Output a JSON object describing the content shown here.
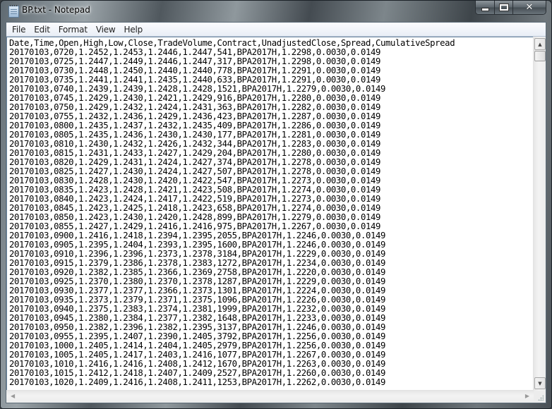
{
  "window": {
    "title": "BP.txt - Notepad",
    "app_icon": "notepad-icon",
    "caption_buttons": {
      "minimize": "minimize-icon",
      "maximize": "maximize-icon",
      "close": "close-icon"
    }
  },
  "menu": {
    "items": [
      "File",
      "Edit",
      "Format",
      "View",
      "Help"
    ]
  },
  "document": {
    "header": "Date,Time,Open,High,Low,Close,TradeVolume,Contract,UnadjustedClose,Spread,CumulativeSpread",
    "lines": [
      "20170103,0720,1.2452,1.2453,1.2446,1.2447,541,BPA2017H,1.2298,0.0030,0.0149",
      "20170103,0725,1.2447,1.2449,1.2446,1.2447,317,BPA2017H,1.2298,0.0030,0.0149",
      "20170103,0730,1.2448,1.2450,1.2440,1.2440,778,BPA2017H,1.2291,0.0030,0.0149",
      "20170103,0735,1.2441,1.2441,1.2435,1.2440,633,BPA2017H,1.2291,0.0030,0.0149",
      "20170103,0740,1.2439,1.2439,1.2428,1.2428,1521,BPA2017H,1.2279,0.0030,0.0149",
      "20170103,0745,1.2429,1.2430,1.2421,1.2429,916,BPA2017H,1.2280,0.0030,0.0149",
      "20170103,0750,1.2429,1.2432,1.2424,1.2431,363,BPA2017H,1.2282,0.0030,0.0149",
      "20170103,0755,1.2432,1.2436,1.2429,1.2436,423,BPA2017H,1.2287,0.0030,0.0149",
      "20170103,0800,1.2435,1.2437,1.2432,1.2435,409,BPA2017H,1.2286,0.0030,0.0149",
      "20170103,0805,1.2435,1.2436,1.2430,1.2430,177,BPA2017H,1.2281,0.0030,0.0149",
      "20170103,0810,1.2430,1.2432,1.2426,1.2432,344,BPA2017H,1.2283,0.0030,0.0149",
      "20170103,0815,1.2431,1.2433,1.2427,1.2429,204,BPA2017H,1.2280,0.0030,0.0149",
      "20170103,0820,1.2429,1.2431,1.2424,1.2427,374,BPA2017H,1.2278,0.0030,0.0149",
      "20170103,0825,1.2427,1.2430,1.2424,1.2427,507,BPA2017H,1.2278,0.0030,0.0149",
      "20170103,0830,1.2428,1.2430,1.2420,1.2422,547,BPA2017H,1.2273,0.0030,0.0149",
      "20170103,0835,1.2423,1.2428,1.2421,1.2423,508,BPA2017H,1.2274,0.0030,0.0149",
      "20170103,0840,1.2423,1.2424,1.2417,1.2422,519,BPA2017H,1.2273,0.0030,0.0149",
      "20170103,0845,1.2423,1.2425,1.2418,1.2423,658,BPA2017H,1.2274,0.0030,0.0149",
      "20170103,0850,1.2423,1.2430,1.2420,1.2428,899,BPA2017H,1.2279,0.0030,0.0149",
      "20170103,0855,1.2427,1.2429,1.2416,1.2416,975,BPA2017H,1.2267,0.0030,0.0149",
      "20170103,0900,1.2416,1.2418,1.2394,1.2395,2055,BPA2017H,1.2246,0.0030,0.0149",
      "20170103,0905,1.2395,1.2404,1.2393,1.2395,1600,BPA2017H,1.2246,0.0030,0.0149",
      "20170103,0910,1.2396,1.2396,1.2373,1.2378,3184,BPA2017H,1.2229,0.0030,0.0149",
      "20170103,0915,1.2379,1.2386,1.2378,1.2383,1272,BPA2017H,1.2234,0.0030,0.0149",
      "20170103,0920,1.2382,1.2385,1.2366,1.2369,2758,BPA2017H,1.2220,0.0030,0.0149",
      "20170103,0925,1.2370,1.2380,1.2370,1.2378,1287,BPA2017H,1.2229,0.0030,0.0149",
      "20170103,0930,1.2377,1.2377,1.2366,1.2373,1301,BPA2017H,1.2224,0.0030,0.0149",
      "20170103,0935,1.2373,1.2379,1.2371,1.2375,1096,BPA2017H,1.2226,0.0030,0.0149",
      "20170103,0940,1.2375,1.2383,1.2374,1.2381,1999,BPA2017H,1.2232,0.0030,0.0149",
      "20170103,0945,1.2380,1.2384,1.2377,1.2382,1648,BPA2017H,1.2233,0.0030,0.0149",
      "20170103,0950,1.2382,1.2396,1.2382,1.2395,3137,BPA2017H,1.2246,0.0030,0.0149",
      "20170103,0955,1.2395,1.2407,1.2390,1.2405,3792,BPA2017H,1.2256,0.0030,0.0149",
      "20170103,1000,1.2405,1.2414,1.2404,1.2405,2979,BPA2017H,1.2256,0.0030,0.0149",
      "20170103,1005,1.2405,1.2417,1.2403,1.2416,1077,BPA2017H,1.2267,0.0030,0.0149",
      "20170103,1010,1.2416,1.2416,1.2408,1.2412,1670,BPA2017H,1.2263,0.0030,0.0149",
      "20170103,1015,1.2412,1.2418,1.2407,1.2409,2527,BPA2017H,1.2260,0.0030,0.0149",
      "20170103,1020,1.2409,1.2416,1.2408,1.2411,1253,BPA2017H,1.2262,0.0030,0.0149"
    ]
  },
  "scrollbars": {
    "vertical": {
      "up": "scroll-up-arrow-icon",
      "down": "scroll-down-arrow-icon"
    },
    "horizontal": {
      "left": "scroll-left-arrow-icon",
      "right": "scroll-right-arrow-icon"
    }
  }
}
